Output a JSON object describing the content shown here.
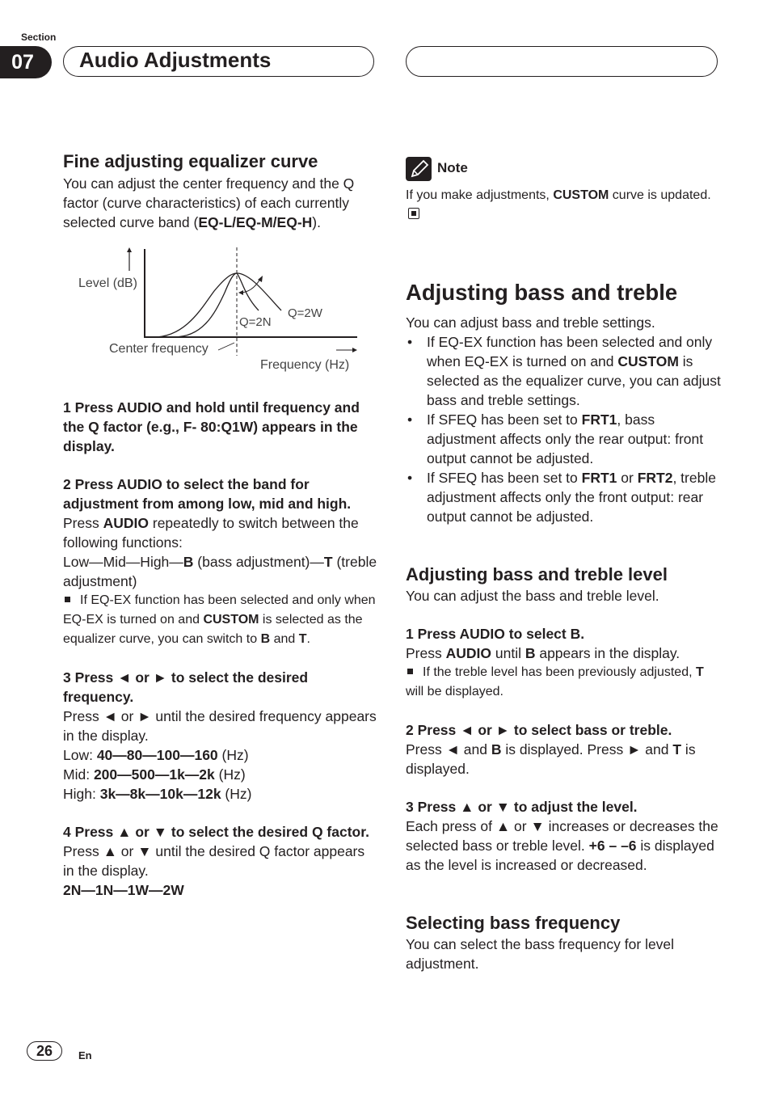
{
  "header": {
    "section_label": "Section",
    "section_number": "07",
    "title": "Audio Adjustments"
  },
  "left": {
    "heading": "Fine adjusting equalizer curve",
    "intro_1": "You can adjust the center frequency and the Q factor (curve characteristics) of each currently selected curve band (",
    "intro_bands": "EQ-L/EQ-M/EQ-H",
    "intro_2": ").",
    "diagram": {
      "y_label": "Level (dB)",
      "x_label": "Frequency (Hz)",
      "center_label": "Center frequency",
      "q_narrow": "Q=2N",
      "q_wide": "Q=2W"
    },
    "step1": "1    Press AUDIO and hold until frequency and the Q factor (e.g., F- 80:Q1W) appears in the display.",
    "step2": "2    Press AUDIO to select the band for adjustment from among low, mid and high.",
    "step2_body_1": "Press ",
    "step2_body_b": "AUDIO",
    "step2_body_2": " repeatedly to switch between the following functions:",
    "step2_seq_1": "Low—Mid—High—",
    "step2_seq_b": "B",
    "step2_seq_2": " (bass adjustment)—",
    "step2_seq_t": "T",
    "step2_seq_3": " (treble adjustment)",
    "step2_note_1": "If EQ-EX function has been selected and only when EQ-EX is turned on and ",
    "step2_note_custom": "CUSTOM",
    "step2_note_2": " is selected as the equalizer curve, you can switch to ",
    "step2_note_b": "B",
    "step2_note_3": " and ",
    "step2_note_t": "T",
    "step2_note_4": ".",
    "step3": "3    Press ◄ or ► to select the desired frequency.",
    "step3_body": "Press ◄ or ► until the desired frequency appears in the display.",
    "low_label": "Low: ",
    "low_values": "40—80—100—160",
    "mid_label": "Mid: ",
    "mid_values": "200—500—1k—2k",
    "high_label": "High: ",
    "high_values": "3k—8k—10k—12k",
    "unit": " (Hz)",
    "step4": "4    Press ▲ or ▼ to select the desired Q factor.",
    "step4_body": "Press ▲ or ▼ until the desired Q factor appears in the display.",
    "q_values": "2N—1N—1W—2W"
  },
  "right": {
    "note_label": "Note",
    "note_1": "If you make adjustments, ",
    "note_custom": "CUSTOM",
    "note_2": " curve is updated.",
    "heading_main": "Adjusting bass and treble",
    "intro": "You can adjust bass and treble settings.",
    "bullet1_1": "If EQ-EX function has been selected and only when EQ-EX is turned on and ",
    "bullet1_custom": "CUSTOM",
    "bullet1_2": " is selected as the equalizer curve, you can adjust bass and treble settings.",
    "bullet2_1": "If SFEQ has been set to ",
    "bullet2_frt1": "FRT1",
    "bullet2_2": ", bass adjustment affects only the rear output: front output cannot be adjusted.",
    "bullet3_1": "If SFEQ has been set to ",
    "bullet3_frt1": "FRT1",
    "bullet3_or": " or ",
    "bullet3_frt2": "FRT2",
    "bullet3_2": ", treble adjustment affects only the front output: rear output cannot be adjusted.",
    "heading_level": "Adjusting bass and treble level",
    "level_intro": "You can adjust the bass and treble level.",
    "l_step1": "1    Press AUDIO to select B.",
    "l_step1_body_1": "Press ",
    "l_step1_body_audio": "AUDIO",
    "l_step1_body_2": " until ",
    "l_step1_body_b": "B",
    "l_step1_body_3": " appears in the display.",
    "l_step1_note_1": "If the treble level has been previously adjusted, ",
    "l_step1_note_t": "T",
    "l_step1_note_2": " will be displayed.",
    "l_step2": "2    Press ◄ or ► to select bass or treble.",
    "l_step2_body_1": "Press ◄ and ",
    "l_step2_body_b": "B",
    "l_step2_body_2": " is displayed. Press ► and ",
    "l_step2_body_t": "T",
    "l_step2_body_3": " is displayed.",
    "l_step3": "3    Press ▲ or ▼ to adjust the level.",
    "l_step3_body_1": "Each press of ▲ or ▼ increases or decreases the selected bass or treble level. ",
    "l_step3_body_range": "+6 – –6",
    "l_step3_body_2": " is displayed as the level is increased or decreased.",
    "heading_freq": "Selecting bass frequency",
    "freq_intro": "You can select the bass frequency for level adjustment."
  },
  "footer": {
    "page_number": "26",
    "language": "En"
  }
}
